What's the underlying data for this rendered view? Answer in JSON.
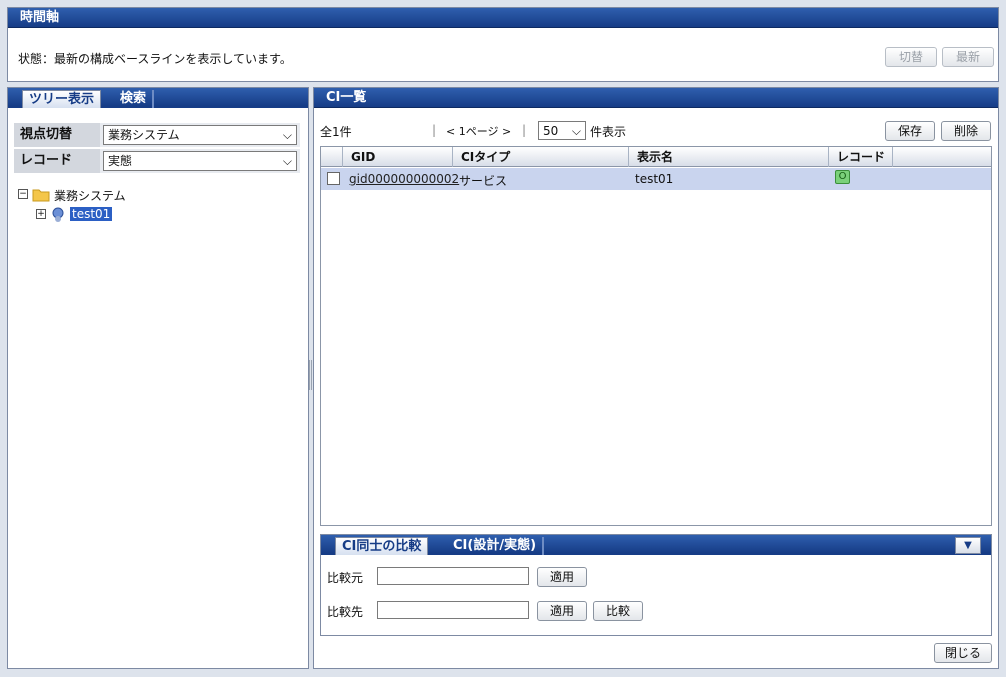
{
  "timeline": {
    "title": "時間軸",
    "status": "状態：最新の構成ベースラインを表示しています。",
    "switch_label": "切替",
    "latest_label": "最新"
  },
  "left": {
    "tabs": [
      "ツリー表示",
      "検索"
    ],
    "viewpoint_label": "視点切替",
    "viewpoint_value": "業務システム",
    "record_label": "レコード",
    "record_value": "実態",
    "tree": {
      "root_label": "業務システム",
      "child_label": "test01"
    }
  },
  "ci_list": {
    "title": "CI一覧",
    "total": "全1件",
    "pager": "< 1ページ >",
    "page_size": "50",
    "page_size_suffix": "件表示",
    "save_label": "保存",
    "delete_label": "削除",
    "columns": [
      "GID",
      "CIタイプ",
      "表示名",
      "レコード"
    ],
    "rows": [
      {
        "gid": "gid000000000002",
        "type": "サービス",
        "name": "test01",
        "record": "O"
      }
    ]
  },
  "compare": {
    "tabs": [
      "CI同士の比較",
      "CI(設計/実態)"
    ],
    "source_label": "比較元",
    "target_label": "比較先",
    "apply_label": "適用",
    "compare_label": "比較"
  },
  "close_label": "閉じる",
  "colors": {
    "header_bar": "#163c86",
    "selected_row": "#c9d4ee",
    "record_badge": "#7ad17a"
  }
}
